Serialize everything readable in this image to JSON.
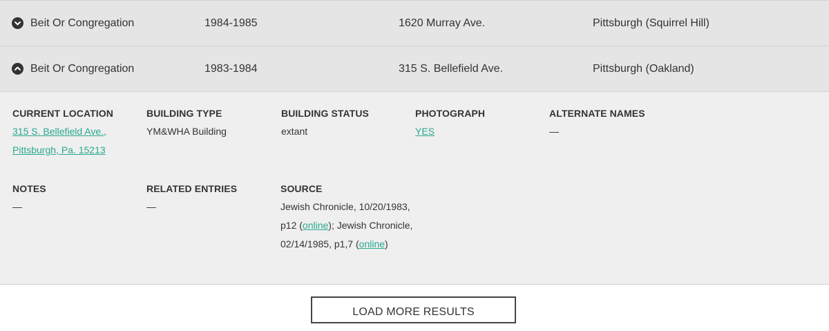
{
  "rows": [
    {
      "name": "Beit Or Congregation",
      "years": "1984-1985",
      "address": "1620 Murray Ave.",
      "city": "Pittsburgh (Squirrel Hill)",
      "toggle_icon": "chevron-down"
    },
    {
      "name": "Beit Or Congregation",
      "years": "1983-1984",
      "address": "315 S. Bellefield Ave.",
      "city": "Pittsburgh (Oakland)",
      "toggle_icon": "chevron-up"
    }
  ],
  "details": {
    "current_location": {
      "label": "CURRENT LOCATION",
      "line1": "315 S. Bellefield Ave.,",
      "line2": "Pittsburgh, Pa. 15213"
    },
    "building_type": {
      "label": "BUILDING TYPE",
      "value": "YM&WHA Building"
    },
    "building_status": {
      "label": "BUILDING STATUS",
      "value": "extant"
    },
    "photograph": {
      "label": "PHOTOGRAPH",
      "value": "YES"
    },
    "alternate_names": {
      "label": "ALTERNATE NAMES",
      "value": "—"
    },
    "notes": {
      "label": "NOTES",
      "value": "—"
    },
    "related_entries": {
      "label": "RELATED ENTRIES",
      "value": "—"
    },
    "source": {
      "label": "SOURCE",
      "line1": "Jewish Chronicle, 10/20/1983,",
      "line2_pre": "p12 (",
      "link1": "online",
      "line2_post": "); Jewish Chronicle,",
      "line3_pre": "02/14/1985, p1,7 (",
      "link2": "online",
      "line3_post": ")"
    }
  },
  "load_more_label": "LOAD MORE RESULTS",
  "colors": {
    "link": "#29a88e",
    "row_bg": "#e5e5e5",
    "details_bg": "#efefef"
  }
}
